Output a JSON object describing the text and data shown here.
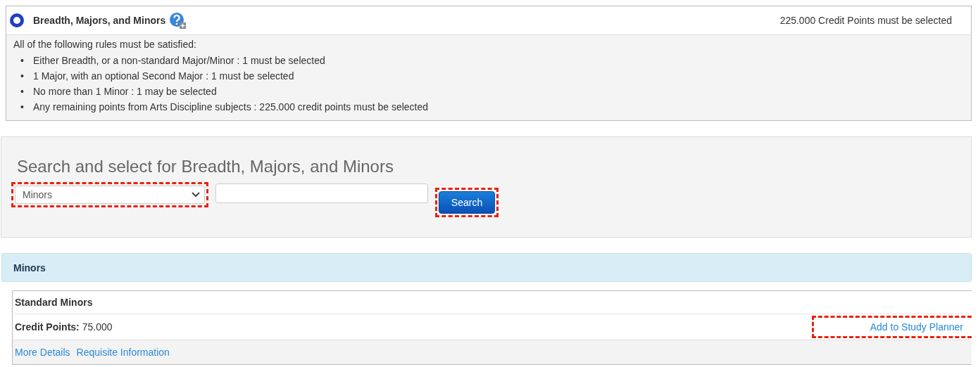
{
  "rules_panel": {
    "title": "Breadth, Majors, and Minors",
    "requirement": "225.000 Credit Points must be selected",
    "intro": "All of the following rules must be satisfied:",
    "rules": [
      {
        "marker": "•",
        "text": "Either Breadth, or a non-standard Major/Minor : 1 must be selected"
      },
      {
        "marker": "•",
        "text": "1 Major, with an optional Second Major : 1 must be selected"
      },
      {
        "marker": "•",
        "text": "No more than 1 Minor : 1 may be selected"
      },
      {
        "marker": "•",
        "text": "Any remaining points from Arts Discipline subjects : 225.000 credit points must be selected"
      }
    ]
  },
  "search_panel": {
    "heading": "Search and select for Breadth, Majors, and Minors",
    "select": {
      "value": "Minors",
      "highlighted": true
    },
    "search_button": {
      "label": "Search",
      "highlighted": true
    }
  },
  "results": {
    "heading": "Minors",
    "items": [
      {
        "name": "Standard Minors",
        "credit_points": "**Credit Points:** 75.000",
        "add_link": {
          "label": "Add to Study Planner",
          "highlighted": true
        },
        "links": [
          "More Details",
          "Requisite Information"
        ]
      }
    ]
  }
}
